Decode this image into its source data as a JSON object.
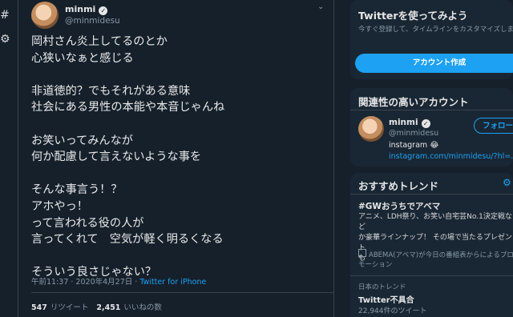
{
  "nav": {
    "icons": [
      "hashtag-icon",
      "gear-icon"
    ],
    "hashtag_glyph": "#",
    "gear_glyph": "⚙"
  },
  "tweet": {
    "display_name": "minmi",
    "handle": "@minmidesu",
    "text": "岡村さん炎上してるのとか\n心狭いなぁと感じる\n\n非道徳的？でもそれがある意味\n社会にある男性の本能や本音じゃんね\n\nお笑いってみんなが\n何か配慮して言えないような事を\n\nそんな事言う！？\nアホやっ！\nって言われる役の人が\n言ってくれて　空気が軽く明るくなる\n\nそういう良さじゃない？",
    "time": "午前11:37 · 2020年4月27日 · ",
    "source": "Twitter for iPhone",
    "retweets": "547",
    "retweets_label": "リツイート",
    "likes": "2,451",
    "likes_label": "いいねの数"
  },
  "signup": {
    "title": "Twitterを使ってみよう",
    "subtitle": "今すぐ登録して、タイムラインをカスタマイズしましょう。",
    "button": "アカウント作成"
  },
  "related": {
    "title": "関連性の高いアカウント",
    "name": "minmi",
    "handle": "@minmidesu",
    "bio": "instagram 😂",
    "link": "instagram.com/minmidesu/?hl=...",
    "follow_button": "フォロー"
  },
  "trends": {
    "title": "おすすめトレンド",
    "t1_name": "#GWおうちでアベマ",
    "t1_desc": "アニメ、LDH祭り、お笑い自宅芸No.1決定戦など\nか豪華ラインナップ！ その場で当たるプレゼント\nも",
    "t1_promo": "ABEMA(アベマ)が今日の番組表からによるプロモーション",
    "t2_context": "日本のトレンド",
    "t2_name": "Twitter不具合",
    "t2_count": "22,944件のツイート"
  },
  "colors": {
    "background": "#15202b",
    "card": "#192734",
    "accent": "#1da1f2",
    "border": "#38444d",
    "secondary_text": "#8899a6"
  }
}
